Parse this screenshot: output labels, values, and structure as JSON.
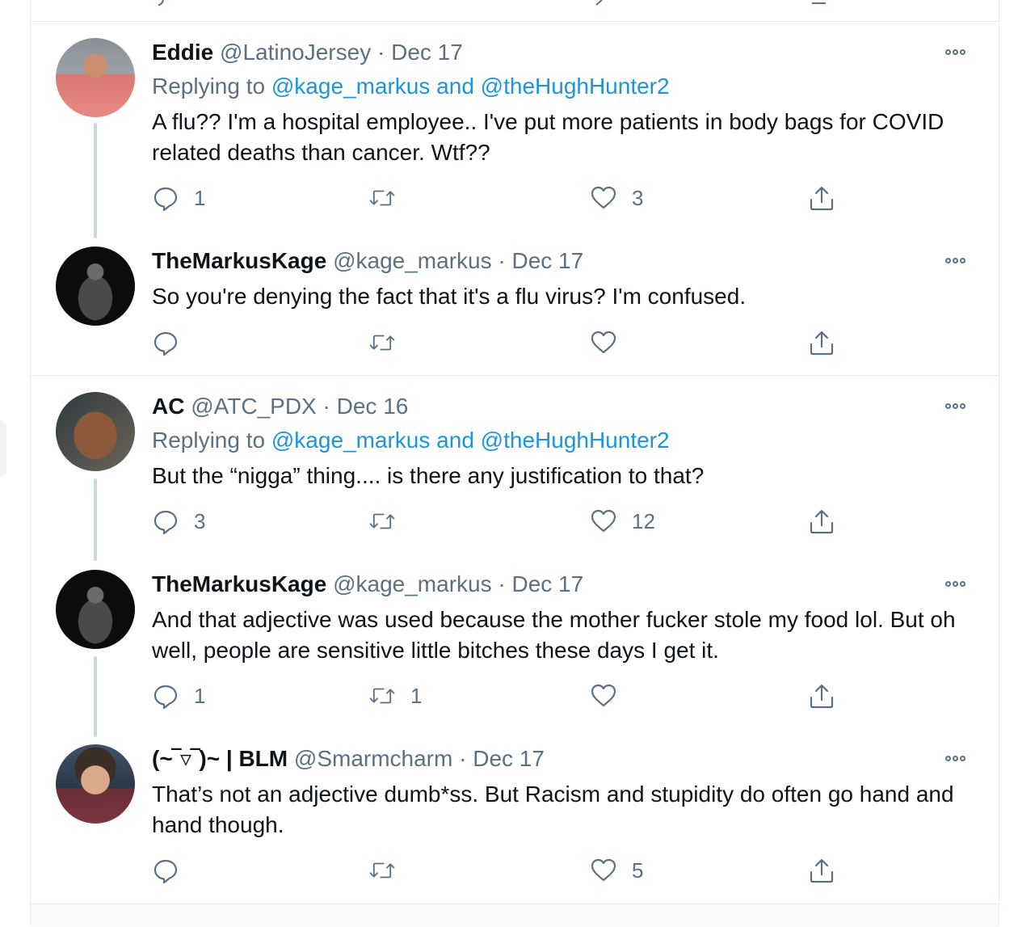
{
  "tweets": [
    {
      "name": "Eddie",
      "handle": "@LatinoJersey",
      "date": "Dec 17",
      "replying_prefix": "Replying to ",
      "mention1": "@kage_markus",
      "and": " and ",
      "mention2": "@theHughHunter2",
      "text": "A flu?? I'm a hospital employee.. I've put more patients in body bags for COVID related deaths than cancer.  Wtf??",
      "replies": "1",
      "retweets": "",
      "likes": "3"
    },
    {
      "name": "TheMarkusKage",
      "handle": "@kage_markus",
      "date": "Dec 17",
      "text": "So you're denying the fact that it's a flu virus? I'm confused.",
      "replies": "",
      "retweets": "",
      "likes": ""
    },
    {
      "name": "AC",
      "handle": "@ATC_PDX",
      "date": "Dec 16",
      "replying_prefix": "Replying to ",
      "mention1": "@kage_markus",
      "and": " and ",
      "mention2": "@theHughHunter2",
      "text": "But the “nigga” thing.... is there any justification to that?",
      "replies": "3",
      "retweets": "",
      "likes": "12"
    },
    {
      "name": "TheMarkusKage",
      "handle": "@kage_markus",
      "date": "Dec 17",
      "text": "And that adjective was used because the mother fucker stole my food lol. But oh well, people are sensitive little bitches these days I get it.",
      "replies": "1",
      "retweets": "1",
      "likes": ""
    },
    {
      "name": "(~‾▿‾)~ | BLM",
      "handle": "@Smarmcharm",
      "date": "Dec 17",
      "text": "That’s not an adjective dumb*ss. But Racism and stupidity do often go hand and hand though.",
      "replies": "",
      "retweets": "",
      "likes": "5"
    }
  ],
  "separator": " · ",
  "icons": {
    "reply": "reply-icon",
    "retweet": "retweet-icon",
    "like": "heart-icon",
    "share": "share-icon",
    "more": "more-icon"
  }
}
